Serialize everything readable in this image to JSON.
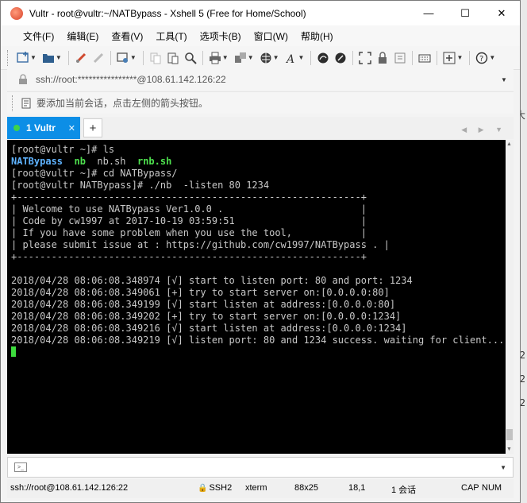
{
  "window": {
    "title": "Vultr - root@vultr:~/NATBypass - Xshell 5 (Free for Home/School)",
    "controls": {
      "minimize": "—",
      "maximize": "☐",
      "close": "✕"
    }
  },
  "menu": [
    "文件(F)",
    "编辑(E)",
    "查看(V)",
    "工具(T)",
    "选项卡(B)",
    "窗口(W)",
    "帮助(H)"
  ],
  "address": {
    "value": "ssh://root:****************@108.61.142.126:22"
  },
  "info": {
    "text": "要添加当前会话，点击左侧的箭头按钮。"
  },
  "tabs": [
    {
      "label": "1 Vultr",
      "close": "✕",
      "status_color": "#3ed34a"
    }
  ],
  "tab_add": "+",
  "terminal": {
    "lines": [
      {
        "segments": [
          {
            "t": "[root@vultr ~]# ls"
          }
        ]
      },
      {
        "segments": [
          {
            "t": "NATBypass",
            "c": "dir"
          },
          {
            "t": "  "
          },
          {
            "t": "nb",
            "c": "exe"
          },
          {
            "t": "  nb.sh  "
          },
          {
            "t": "rnb.sh",
            "c": "exe"
          }
        ]
      },
      {
        "segments": [
          {
            "t": "[root@vultr ~]# cd NATBypass/"
          }
        ]
      },
      {
        "segments": [
          {
            "t": "[root@vultr NATBypass]# ./nb  -listen 80 1234"
          }
        ]
      },
      {
        "segments": [
          {
            "t": "+------------------------------------------------------------+"
          }
        ]
      },
      {
        "segments": [
          {
            "t": "| Welcome to use NATBypass Ver1.0.0 .                        |"
          }
        ]
      },
      {
        "segments": [
          {
            "t": "| Code by cw1997 at 2017-10-19 03:59:51                      |"
          }
        ]
      },
      {
        "segments": [
          {
            "t": "| If you have some problem when you use the tool,            |"
          }
        ]
      },
      {
        "segments": [
          {
            "t": "| please submit issue at : https://github.com/cw1997/NATBypass . |"
          }
        ]
      },
      {
        "segments": [
          {
            "t": "+------------------------------------------------------------+"
          }
        ]
      },
      {
        "segments": [
          {
            "t": ""
          }
        ]
      },
      {
        "segments": [
          {
            "t": "2018/04/28 08:06:08.348974 [√] start to listen port: 80 and port: 1234"
          }
        ]
      },
      {
        "segments": [
          {
            "t": "2018/04/28 08:06:08.349061 [+] try to start server on:[0.0.0.0:80]"
          }
        ]
      },
      {
        "segments": [
          {
            "t": "2018/04/28 08:06:08.349199 [√] start listen at address:[0.0.0.0:80]"
          }
        ]
      },
      {
        "segments": [
          {
            "t": "2018/04/28 08:06:08.349202 [+] try to start server on:[0.0.0.0:1234]"
          }
        ]
      },
      {
        "segments": [
          {
            "t": "2018/04/28 08:06:08.349216 [√] start listen at address:[0.0.0.0:1234]"
          }
        ]
      },
      {
        "segments": [
          {
            "t": "2018/04/28 08:06:08.349219 [√] listen port: 80 and 1234 success. waiting for client..."
          }
        ]
      }
    ]
  },
  "status": {
    "connection": "ssh://root@108.61.142.126:22",
    "protocol": "SSH2",
    "terminal_type": "xterm",
    "size": "88x25",
    "position": "18,1",
    "sessions": "1 会话",
    "caps": "CAP",
    "num": "NUM"
  },
  "backdrop_chars": [
    "大",
    "2",
    "2",
    "2"
  ],
  "colors": {
    "accent": "#0c8ee6",
    "directory": "#5fb3ff",
    "executable": "#4ee04e",
    "cursor": "#3ddc3d"
  }
}
